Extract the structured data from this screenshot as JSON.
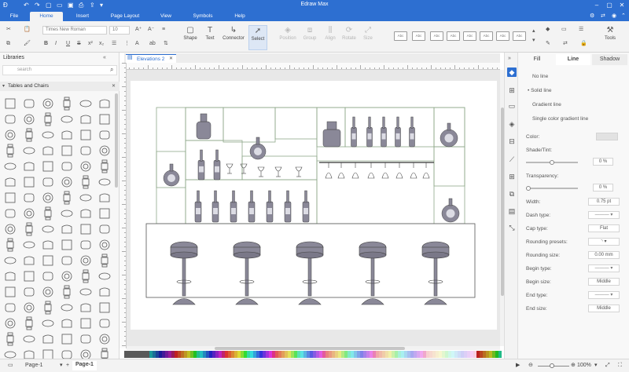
{
  "titlebar": {
    "title": "Edraw Max"
  },
  "menu": {
    "tabs": [
      "File",
      "Home",
      "Insert",
      "Page Layout",
      "View",
      "Symbols",
      "Help"
    ],
    "active_tab": "Home"
  },
  "ribbon": {
    "font_name": "Times New Roman",
    "font_size": "10",
    "buttons": {
      "shape": "Shape",
      "text": "Text",
      "connector": "Connector",
      "select": "Select",
      "position": "Position",
      "group": "Group",
      "align": "Align",
      "rotate": "Rotate",
      "size": "Size",
      "tools": "Tools"
    },
    "style_preset_label": "Abc"
  },
  "library": {
    "title": "Libraries",
    "search_placeholder": "search",
    "section": "Tables and Chairs"
  },
  "document": {
    "tab_label": "Elevations 2"
  },
  "properties": {
    "tabs": [
      "Fill",
      "Line",
      "Shadow"
    ],
    "active_tab": "Line",
    "line_options": [
      "No line",
      "Solid line",
      "Gradient line",
      "Single color gradient line"
    ],
    "selected_line_option": "Solid line",
    "color_label": "Color:",
    "shade_label": "Shade/Tint:",
    "shade_value": "0 %",
    "transparency_label": "Transparency:",
    "transparency_value": "0 %",
    "width_label": "Width:",
    "width_value": "0.75 pt",
    "dash_label": "Dash type:",
    "cap_label": "Cap type:",
    "cap_value": "Flat",
    "rounding_presets_label": "Rounding presets:",
    "rounding_size_label": "Rounding size:",
    "rounding_size_value": "0.00 mm",
    "begin_type_label": "Begin type:",
    "begin_size_label": "Begin size:",
    "begin_size_value": "Middle",
    "end_type_label": "End type:",
    "end_size_label": "End size:",
    "end_size_value": "Middle"
  },
  "statusbar": {
    "page_selector": "Page-1",
    "page_tab": "Page-1",
    "zoom": "100%"
  },
  "colors": {
    "accent": "#2d6fd1",
    "shelf_outline": "#8fa88a",
    "bottle_fill": "#8a8898"
  }
}
